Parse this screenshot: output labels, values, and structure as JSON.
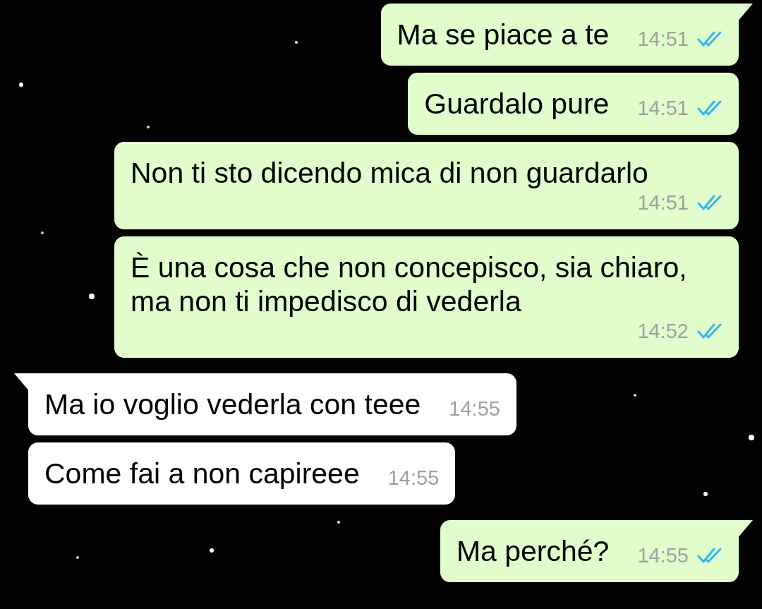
{
  "messages": [
    {
      "kind": "outgoing",
      "tail": true,
      "text": "Ma se piace a te",
      "time": "14:51",
      "read": true
    },
    {
      "kind": "outgoing",
      "tail": false,
      "text": "Guardalo pure",
      "time": "14:51",
      "read": true
    },
    {
      "kind": "outgoing",
      "tail": false,
      "text": "Non ti sto dicendo mica di non guardarlo",
      "time": "14:51",
      "read": true
    },
    {
      "kind": "outgoing",
      "tail": false,
      "text": "È una cosa che non concepisco, sia chiaro, ma non ti impedisco di vederla",
      "time": "14:52",
      "read": true
    },
    {
      "kind": "incoming",
      "tail": true,
      "text": "Ma io voglio vederla con teee",
      "time": "14:55"
    },
    {
      "kind": "incoming",
      "tail": false,
      "text": "Come fai a non capireee",
      "time": "14:55"
    },
    {
      "kind": "outgoing",
      "tail": true,
      "text": "Ma perché?",
      "time": "14:55",
      "read": true
    }
  ]
}
